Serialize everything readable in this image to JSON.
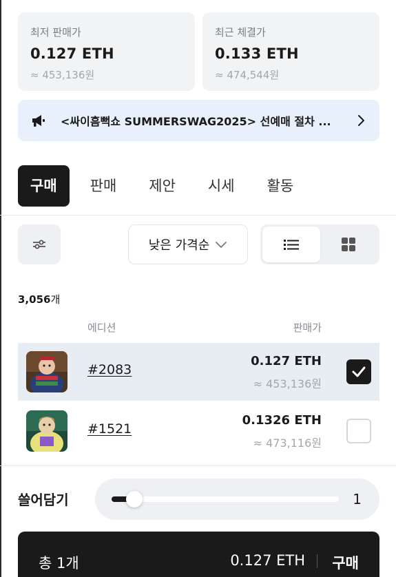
{
  "price_cards": {
    "lowest": {
      "label": "최저 판매가",
      "eth": "0.127 ETH",
      "krw": "≈ 453,136원"
    },
    "recent": {
      "label": "최근 체결가",
      "eth": "0.133 ETH",
      "krw": "≈ 474,544원"
    }
  },
  "notice": {
    "text": "<싸이흠뻑쇼 SUMMERSWAG2025> 선예매 절차 ...",
    "icon": "megaphone-icon"
  },
  "tabs": [
    {
      "label": "구매",
      "active": true
    },
    {
      "label": "판매",
      "active": false
    },
    {
      "label": "제안",
      "active": false
    },
    {
      "label": "시세",
      "active": false
    },
    {
      "label": "활동",
      "active": false
    }
  ],
  "toolbar": {
    "sort_label": "낮은 가격순"
  },
  "list": {
    "count": "3,056",
    "count_unit": "개",
    "col_edition": "에디션",
    "col_price": "판매가",
    "rows": [
      {
        "edition": "#2083",
        "eth": "0.127 ETH",
        "krw": "≈ 453,136원",
        "checked": true
      },
      {
        "edition": "#1521",
        "eth": "0.1326 ETH",
        "krw": "≈ 473,116원",
        "checked": false
      }
    ]
  },
  "sweep": {
    "label": "쓸어담기",
    "value": "1",
    "fill_fraction": 0.1
  },
  "buybar": {
    "total": "총 1개",
    "eth": "0.127 ETH",
    "buy": "구매"
  },
  "colors": {
    "accent_dark": "#1a1a1a",
    "banner_bg": "#e7f0fb",
    "selected_row": "#e8edf3"
  }
}
